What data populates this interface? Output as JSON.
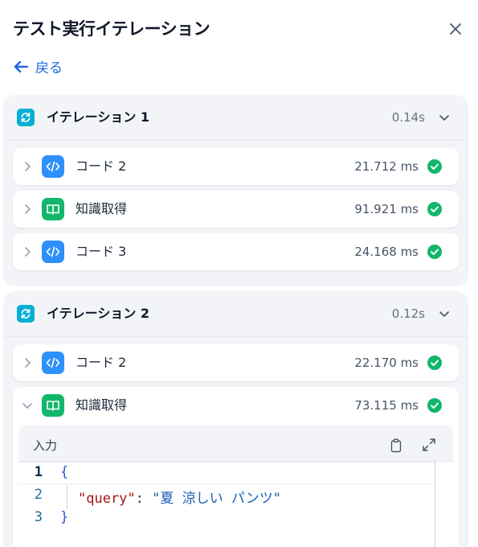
{
  "panel": {
    "title": "テスト実行イテレーション",
    "back_label": "戻る"
  },
  "iterations": [
    {
      "label": "イテレーション 1",
      "time": "0.14s",
      "nodes": [
        {
          "label": "コード 2",
          "time": "21.712 ms",
          "type": "code"
        },
        {
          "label": "知識取得",
          "time": "91.921 ms",
          "type": "knowledge"
        },
        {
          "label": "コード 3",
          "time": "24.168 ms",
          "type": "code"
        }
      ]
    },
    {
      "label": "イテレーション 2",
      "time": "0.12s",
      "nodes": [
        {
          "label": "コード 2",
          "time": "22.170 ms",
          "type": "code"
        },
        {
          "label": "知識取得",
          "time": "73.115 ms",
          "type": "knowledge"
        }
      ]
    }
  ],
  "input_section": {
    "label": "入力",
    "code_lines": [
      {
        "num": "1",
        "text": "{"
      },
      {
        "num": "2",
        "key": "\"query\"",
        "colon": ": ",
        "value": "\"夏 涼しい パンツ\""
      },
      {
        "num": "3",
        "text": "}"
      }
    ]
  },
  "colors": {
    "accent": "#1d67e0",
    "iteration_icon": "#06aed4",
    "code_icon": "#2e90fa",
    "knowledge_icon": "#12b76a",
    "success": "#12b76a"
  },
  "icons": {
    "close": "close-icon",
    "back": "arrow-left-icon",
    "iteration": "refresh-icon",
    "code": "code-icon",
    "knowledge": "book-open-icon",
    "status": "check-circle-icon",
    "copy": "clipboard-icon",
    "expand": "expand-icon"
  }
}
